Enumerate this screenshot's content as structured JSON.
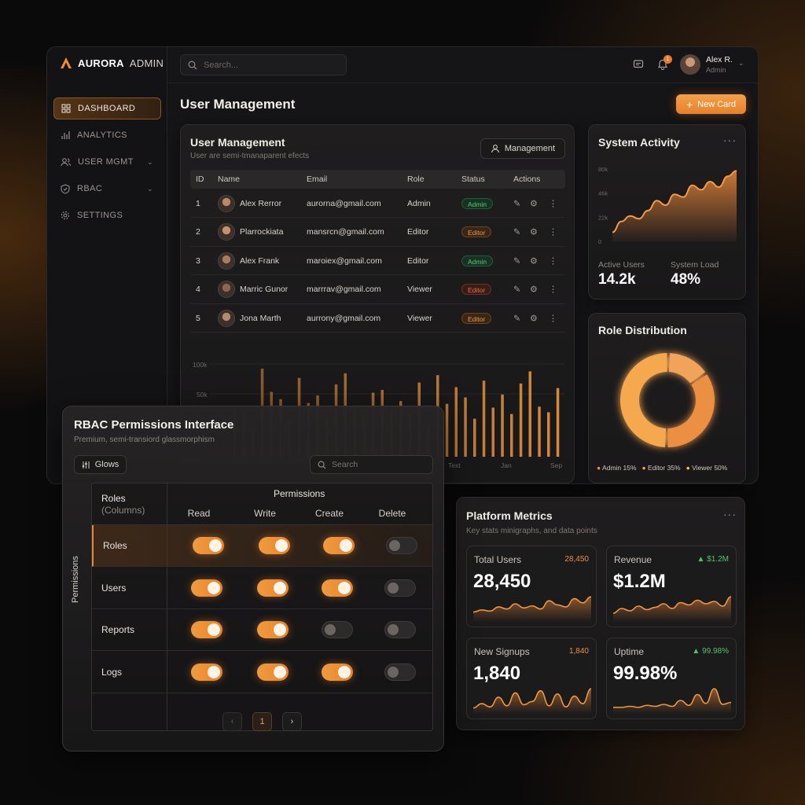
{
  "app": {
    "brand_bold": "AURORA",
    "brand_rest": "ADMIN"
  },
  "sidebar": {
    "items": [
      {
        "label": "DASHBOARD",
        "icon": "grid-icon",
        "active": true
      },
      {
        "label": "ANALYTICS",
        "icon": "bar-chart-icon"
      },
      {
        "label": "USER MGMT",
        "icon": "users-icon",
        "expandable": true
      },
      {
        "label": "RBAC",
        "icon": "shield-icon",
        "expandable": true
      },
      {
        "label": "SETTINGS",
        "icon": "gear-icon"
      }
    ]
  },
  "topbar": {
    "search_placeholder": "Search...",
    "notification_count": "1",
    "user_name": "Alex R.",
    "user_role": "Admin"
  },
  "page": {
    "title": "User Management",
    "new_card_label": "New Card"
  },
  "user_card": {
    "title": "User Management",
    "subtitle": "User are semi-tmanaparent efects",
    "button_label": "Management",
    "columns": [
      "ID",
      "Name",
      "Email",
      "Role",
      "Status",
      "Actions"
    ],
    "rows": [
      {
        "id": "1",
        "name": "Alex Rerror",
        "email": "aurorna@gmail.com",
        "role": "Admin",
        "status": "Admin",
        "status_color": "green"
      },
      {
        "id": "2",
        "name": "Plarrockiata",
        "email": "mansrcn@gmail.com",
        "role": "Editor",
        "status": "Editor",
        "status_color": "orange"
      },
      {
        "id": "3",
        "name": "Alex Frank",
        "email": "maroiex@gmail.com",
        "role": "Editor",
        "status": "Admin",
        "status_color": "green"
      },
      {
        "id": "4",
        "name": "Marric Gunor",
        "email": "marrrav@gmail.com",
        "role": "Viewer",
        "status": "Editor",
        "status_color": "red"
      },
      {
        "id": "5",
        "name": "Jona Marth",
        "email": "aurrony@gmail.com",
        "role": "Viewer",
        "status": "Editor",
        "status_color": "orange"
      }
    ]
  },
  "chart_data": [
    {
      "type": "bar",
      "y_ticks": [
        "100k",
        "50k"
      ],
      "x_ticks": [
        "Text",
        "Jan",
        "Sep"
      ],
      "ylim": [
        0,
        100000
      ],
      "values": [
        52000,
        48000,
        30000,
        95000,
        70000,
        62000,
        38000,
        85000,
        58000,
        66000,
        43000,
        78000,
        90000,
        55000,
        44000,
        69000,
        72000,
        50000,
        60000,
        47000,
        80000,
        35000,
        88000,
        57000,
        75000,
        64000,
        41000,
        82000,
        53000,
        67000,
        46000,
        79000,
        92000,
        54000,
        48000,
        74000
      ],
      "color": "#d98a3e"
    },
    {
      "type": "area",
      "title": "System Activity",
      "y_ticks": [
        "80k",
        "46k",
        "22k",
        "0"
      ],
      "ylim": [
        0,
        80000
      ],
      "values": [
        10000,
        22000,
        28000,
        25000,
        34000,
        45000,
        40000,
        52000,
        49000,
        62000,
        57000,
        66000,
        60000,
        72000,
        78000
      ],
      "color": "#e8873a"
    },
    {
      "type": "pie",
      "title": "Role Distribution",
      "labels": [
        "Admin 15%",
        "Editor 35%",
        "Viewer 50%"
      ],
      "values": [
        15,
        35,
        50
      ],
      "colors": [
        "#f2a35a",
        "#eb8f42",
        "#f5a84e"
      ]
    }
  ],
  "activity": {
    "title": "System Activity",
    "stat1_label": "Active Users",
    "stat1_value": "14.2k",
    "stat2_label": "System Load",
    "stat2_value": "48%"
  },
  "roles": {
    "title": "Role Distribution",
    "legend": [
      "Admin 15%",
      "Editor 35%",
      "Viewer 50%"
    ],
    "legend_colors": [
      "#f08a3c",
      "#f2a24a",
      "#f7c15a"
    ]
  },
  "rbac": {
    "title": "RBAC Permissions Interface",
    "subtitle": "Premium, semi-transiord glassmorphism",
    "glows_label": "Glows",
    "search_placeholder": "Search",
    "roles_header": "Roles",
    "roles_header_sub": "(Columns)",
    "permissions_header": "Permissions",
    "side_label": "Permissions",
    "columns": [
      "Read",
      "Write",
      "Create",
      "Delete"
    ],
    "rows": [
      {
        "label": "Roles",
        "perms": [
          true,
          true,
          true,
          false
        ],
        "highlight": true
      },
      {
        "label": "Users",
        "perms": [
          true,
          true,
          true,
          false
        ]
      },
      {
        "label": "Reports",
        "perms": [
          true,
          true,
          false,
          false
        ]
      },
      {
        "label": "Logs",
        "perms": [
          true,
          true,
          true,
          false
        ]
      }
    ],
    "page": "1"
  },
  "metrics": {
    "title": "Platform Metrics",
    "subtitle": "Key stats minigraphs, and data points",
    "cards": [
      {
        "label": "Total Users",
        "value": "28,450",
        "side": "28,450",
        "side_color": "#e8903f",
        "spark": [
          8,
          10,
          9,
          13,
          11,
          16,
          12,
          14,
          11,
          19,
          15,
          13,
          21,
          17,
          23
        ]
      },
      {
        "label": "Revenue",
        "value": "$1.2M",
        "side": "▲ $1.2M",
        "side_color": "#4fc46f",
        "spark": [
          6,
          10,
          8,
          12,
          9,
          11,
          14,
          10,
          15,
          13,
          17,
          14,
          16,
          12,
          20
        ]
      },
      {
        "label": "New Signups",
        "value": "1,840",
        "side": "1,840",
        "side_color": "#e8903f",
        "spark": [
          4,
          8,
          5,
          14,
          6,
          18,
          7,
          10,
          20,
          6,
          17,
          5,
          15,
          8,
          22
        ]
      },
      {
        "label": "Uptime",
        "value": "99.98%",
        "side": "▲ 99.98%",
        "side_color": "#4fc46f",
        "spark": [
          5,
          5,
          6,
          5,
          7,
          6,
          8,
          6,
          12,
          7,
          18,
          9,
          24,
          8,
          10
        ]
      }
    ]
  }
}
